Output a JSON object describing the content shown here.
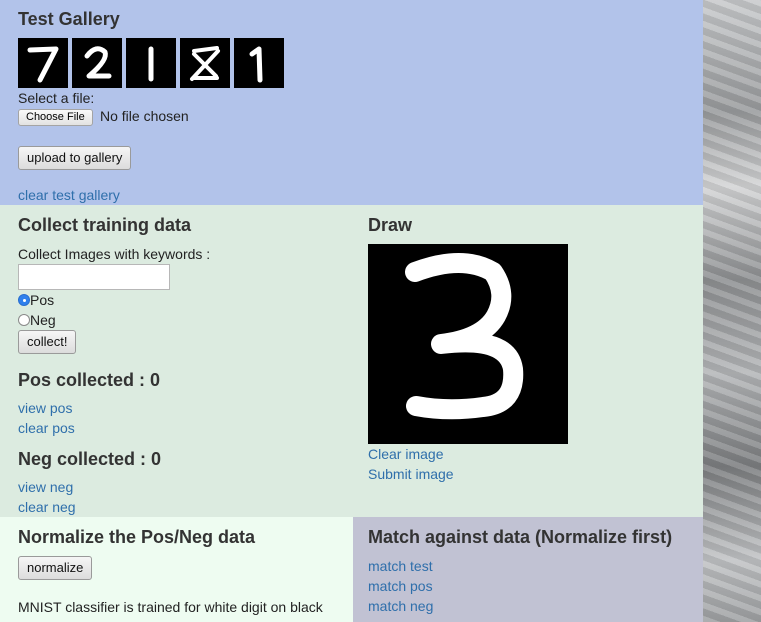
{
  "test_gallery": {
    "title": "Test Gallery",
    "digits": [
      "7",
      "2",
      "1",
      "8",
      "1"
    ],
    "select_file_label": "Select a file:",
    "choose_file_label": "Choose File",
    "file_status": "No file chosen",
    "upload_label": "upload to gallery",
    "clear_label": "clear test gallery"
  },
  "collect": {
    "title": "Collect training data",
    "keywords_label": "Collect Images with keywords :",
    "keywords_value": "",
    "pos_label": "Pos",
    "neg_label": "Neg",
    "selected": "Pos",
    "collect_label": "collect!",
    "pos_collected": "Pos collected : 0",
    "view_pos": "view pos",
    "clear_pos": "clear pos",
    "neg_collected": "Neg collected : 0",
    "view_neg": "view neg",
    "clear_neg": "clear neg"
  },
  "draw": {
    "title": "Draw",
    "drawn_digit": "3",
    "clear_image": "Clear image",
    "submit_image": "Submit image"
  },
  "normalize": {
    "title": "Normalize the Pos/Neg data",
    "button_label": "normalize",
    "note": "MNIST classifier is trained for white digit on black background"
  },
  "match": {
    "title": "Match against data (Normalize first)",
    "match_test": "match test",
    "match_pos": "match pos",
    "match_neg": "match neg"
  },
  "colors": {
    "test_panel": "#b2c3ea",
    "train_panel": "#dcebe0",
    "normalize_panel": "#eefcf1",
    "match_panel": "#c1c2d3",
    "link": "#2f6fab"
  }
}
